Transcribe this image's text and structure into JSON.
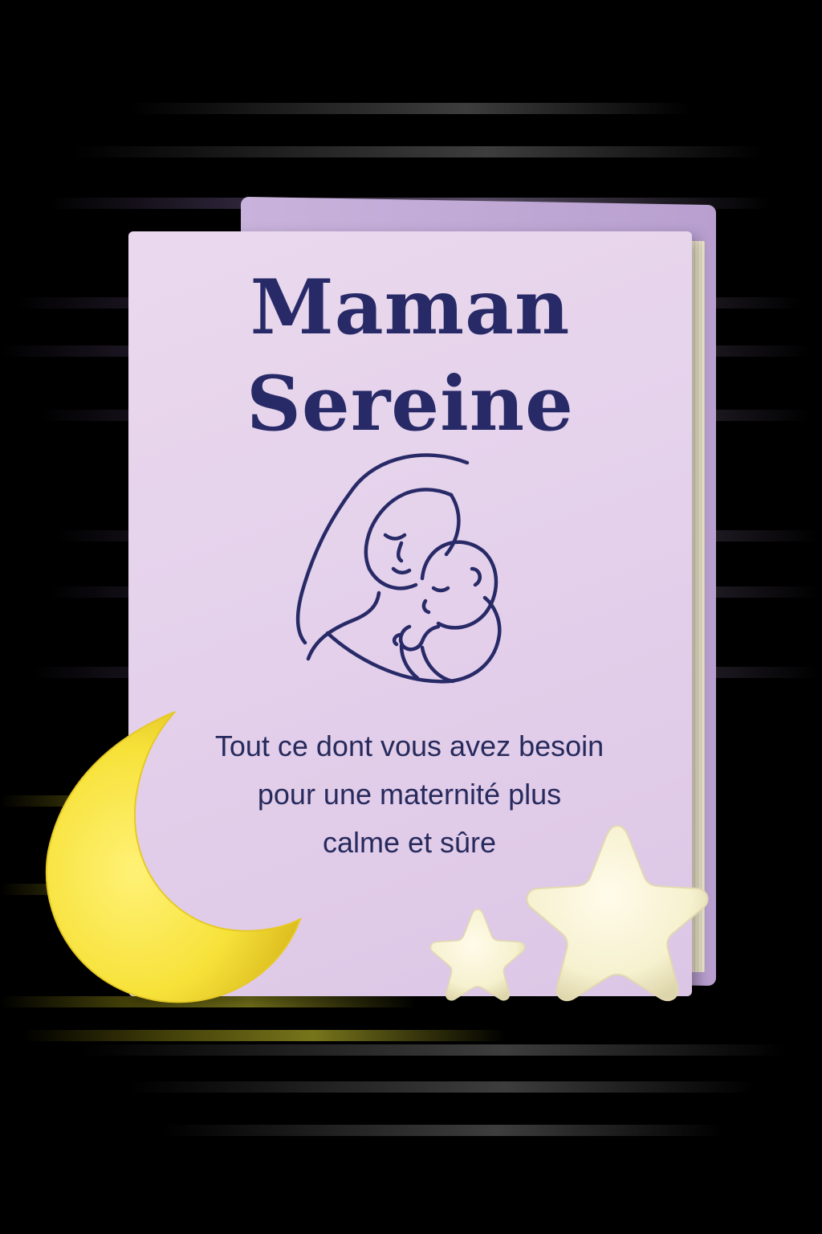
{
  "book": {
    "title_line1": "Maman",
    "title_line2": "Sereine",
    "subtitle_line1": "Tout ce dont vous avez besoin",
    "subtitle_line2": "pour une maternité plus",
    "subtitle_line3": "calme et sûre"
  },
  "colors": {
    "background": "#000000",
    "cover": "#e6d3ec",
    "title_text": "#282a68",
    "subtitle_text": "#262a5c",
    "moon": "#f7e23a",
    "stars": "#f6f1cf"
  },
  "decorations": {
    "illustration_icon": "mother-holding-baby-icon",
    "moon_icon": "crescent-moon-icon",
    "star_icon": "star-icon"
  }
}
